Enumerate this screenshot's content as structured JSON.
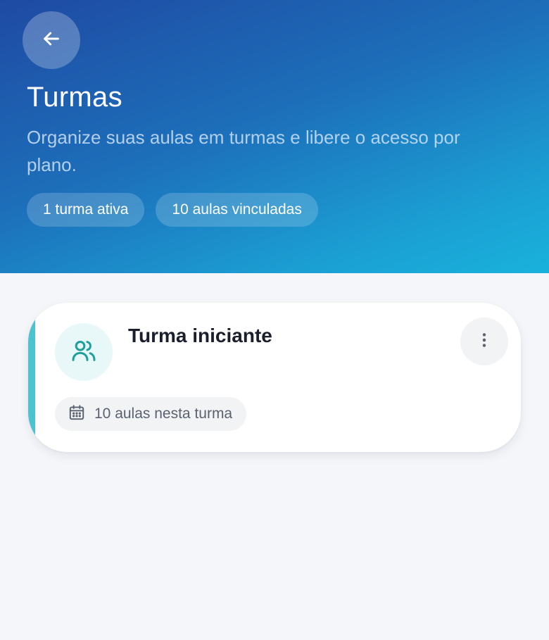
{
  "header": {
    "back_icon": "arrow-left-icon",
    "title": "Turmas",
    "subtitle": "Organize suas aulas em turmas e libere o acesso por plano.",
    "chips": [
      {
        "label": "1 turma ativa"
      },
      {
        "label": "10 aulas vinculadas"
      }
    ],
    "gradient_colors": [
      "#1e4aa3",
      "#19b2dc"
    ]
  },
  "classes": [
    {
      "name": "Turma iniciante",
      "icon": "users-icon",
      "menu_icon": "more-vertical-icon",
      "meta_icon": "calendar-icon",
      "meta_label": "10 aulas nesta turma",
      "accent_color": "#4cc3cf"
    }
  ]
}
